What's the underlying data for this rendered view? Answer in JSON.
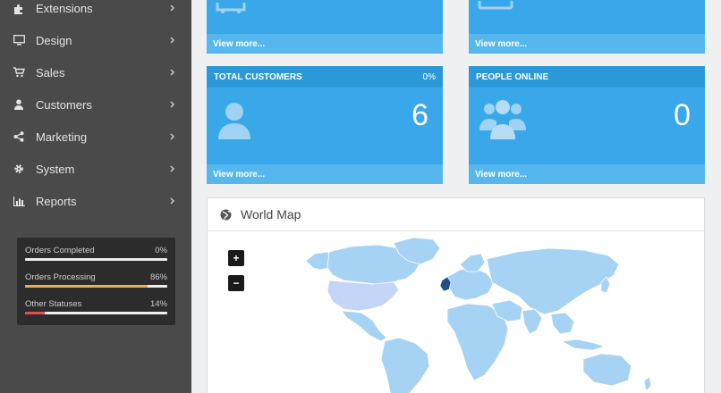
{
  "sidebar": {
    "items": [
      {
        "label": "Extensions",
        "icon": "puzzle-icon"
      },
      {
        "label": "Design",
        "icon": "monitor-icon"
      },
      {
        "label": "Sales",
        "icon": "cart-icon"
      },
      {
        "label": "Customers",
        "icon": "user-icon"
      },
      {
        "label": "Marketing",
        "icon": "share-icon"
      },
      {
        "label": "System",
        "icon": "gear-icon"
      },
      {
        "label": "Reports",
        "icon": "bar-chart-icon"
      }
    ],
    "stats": [
      {
        "label": "Orders Completed",
        "value": "0%",
        "fraction": 0.0,
        "color": "#e0e0e0"
      },
      {
        "label": "Orders Processing",
        "value": "86%",
        "fraction": 0.86,
        "color": "#f0ad4e"
      },
      {
        "label": "Other Statuses",
        "value": "14%",
        "fraction": 0.14,
        "color": "#d9534f"
      }
    ]
  },
  "tiles": {
    "top_left": {
      "view_more": "View more..."
    },
    "top_right": {
      "view_more": "View more..."
    },
    "customers": {
      "title": "TOTAL CUSTOMERS",
      "percent": "0%",
      "value": "6",
      "view_more": "View more...",
      "icon": "user-icon"
    },
    "online": {
      "title": "PEOPLE ONLINE",
      "value": "0",
      "view_more": "View more...",
      "icon": "users-icon"
    }
  },
  "map": {
    "title": "World Map",
    "zoom_in": "+",
    "zoom_out": "−",
    "colors": {
      "land": "#a6d3f3",
      "highlight_usa": "#c4d5f7",
      "highlight_uk": "#1f4e8c"
    }
  },
  "colors": {
    "sidebar": "#4a4a4a",
    "tile": "#38a8ea",
    "tile_header": "#2b98d8",
    "tile_footer": "#56b7ee"
  }
}
